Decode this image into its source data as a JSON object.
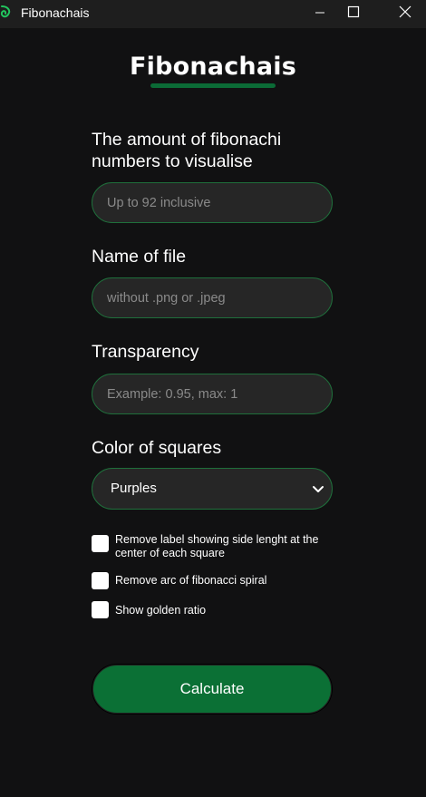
{
  "window": {
    "title": "Fibonachais",
    "controls": {
      "minimize": "minimize-icon",
      "maximize": "maximize-icon",
      "close": "close-icon"
    }
  },
  "header": {
    "brand": "Fibonachais"
  },
  "form": {
    "amount": {
      "label": "The amount of fibonachi numbers to visualise",
      "value": "",
      "placeholder": "Up to 92 inclusive"
    },
    "filename": {
      "label": "Name of file",
      "value": "",
      "placeholder": "without .png or .jpeg"
    },
    "transparency": {
      "label": "Transparency",
      "value": "",
      "placeholder": "Example: 0.95, max: 1"
    },
    "color": {
      "label": "Color of squares",
      "selected": "Purples"
    },
    "options": [
      {
        "label": "Remove label showing side lenght at the center of each square",
        "checked": false
      },
      {
        "label": "Remove arc of fibonacci spiral",
        "checked": false
      },
      {
        "label": "Show golden ratio",
        "checked": false
      }
    ],
    "submit_label": "Calculate"
  },
  "colors": {
    "background": "#111112",
    "accent": "#0b7035",
    "field_border": "#1f6f3b",
    "field_bg": "#262626"
  }
}
